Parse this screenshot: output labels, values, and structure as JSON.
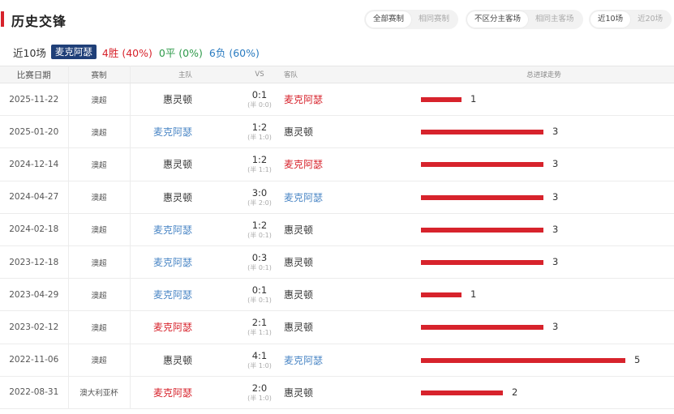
{
  "header": {
    "title": "历史交锋",
    "filters": {
      "competition": [
        {
          "label": "全部赛制",
          "active": true
        },
        {
          "label": "相同赛制",
          "active": false
        }
      ],
      "venue": [
        {
          "label": "不区分主客场",
          "active": true
        },
        {
          "label": "相同主客场",
          "active": false
        }
      ],
      "range": [
        {
          "label": "近10场",
          "active": true
        },
        {
          "label": "近20场",
          "active": false
        }
      ]
    }
  },
  "summary": {
    "recent": "近10场",
    "team": "麦克阿瑟",
    "win": "4胜 (40%)",
    "draw": "0平 (0%)",
    "loss": "6负 (60%)"
  },
  "columns": {
    "date": "比赛日期",
    "competition": "赛制",
    "home": "主队",
    "vs": "VS",
    "away": "客队",
    "trend": "总进球走势"
  },
  "colors": {
    "accent_red": "#d7232c",
    "team_blue": "#4a86c5",
    "tag_navy": "#1f3f78",
    "draw_green": "#2e9a4a"
  },
  "rows": [
    {
      "date": "2025-11-22",
      "competition": "澳超",
      "home": "惠灵顿",
      "home_style": "other",
      "score": "0:1",
      "half": "(半 0:0)",
      "away": "麦克阿瑟",
      "away_style": "macarthur-red",
      "total": 1
    },
    {
      "date": "2025-01-20",
      "competition": "澳超",
      "home": "麦克阿瑟",
      "home_style": "macarthur-home",
      "score": "1:2",
      "half": "(半 1:0)",
      "away": "惠灵顿",
      "away_style": "other",
      "total": 3
    },
    {
      "date": "2024-12-14",
      "competition": "澳超",
      "home": "惠灵顿",
      "home_style": "other",
      "score": "1:2",
      "half": "(半 1:1)",
      "away": "麦克阿瑟",
      "away_style": "macarthur-red",
      "total": 3
    },
    {
      "date": "2024-04-27",
      "competition": "澳超",
      "home": "惠灵顿",
      "home_style": "other",
      "score": "3:0",
      "half": "(半 2:0)",
      "away": "麦克阿瑟",
      "away_style": "macarthur-home",
      "total": 3
    },
    {
      "date": "2024-02-18",
      "competition": "澳超",
      "home": "麦克阿瑟",
      "home_style": "macarthur-home",
      "score": "1:2",
      "half": "(半 0:1)",
      "away": "惠灵顿",
      "away_style": "other",
      "total": 3
    },
    {
      "date": "2023-12-18",
      "competition": "澳超",
      "home": "麦克阿瑟",
      "home_style": "macarthur-home",
      "score": "0:3",
      "half": "(半 0:1)",
      "away": "惠灵顿",
      "away_style": "other",
      "total": 3
    },
    {
      "date": "2023-04-29",
      "competition": "澳超",
      "home": "麦克阿瑟",
      "home_style": "macarthur-home",
      "score": "0:1",
      "half": "(半 0:1)",
      "away": "惠灵顿",
      "away_style": "other",
      "total": 1
    },
    {
      "date": "2023-02-12",
      "competition": "澳超",
      "home": "麦克阿瑟",
      "home_style": "macarthur-red",
      "score": "2:1",
      "half": "(半 1:1)",
      "away": "惠灵顿",
      "away_style": "other",
      "total": 3
    },
    {
      "date": "2022-11-06",
      "competition": "澳超",
      "home": "惠灵顿",
      "home_style": "other",
      "score": "4:1",
      "half": "(半 1:0)",
      "away": "麦克阿瑟",
      "away_style": "macarthur-home",
      "total": 5
    },
    {
      "date": "2022-08-31",
      "competition": "澳大利亚杯",
      "home": "麦克阿瑟",
      "home_style": "macarthur-red",
      "score": "2:0",
      "half": "(半 1:0)",
      "away": "惠灵顿",
      "away_style": "other",
      "total": 2
    }
  ]
}
